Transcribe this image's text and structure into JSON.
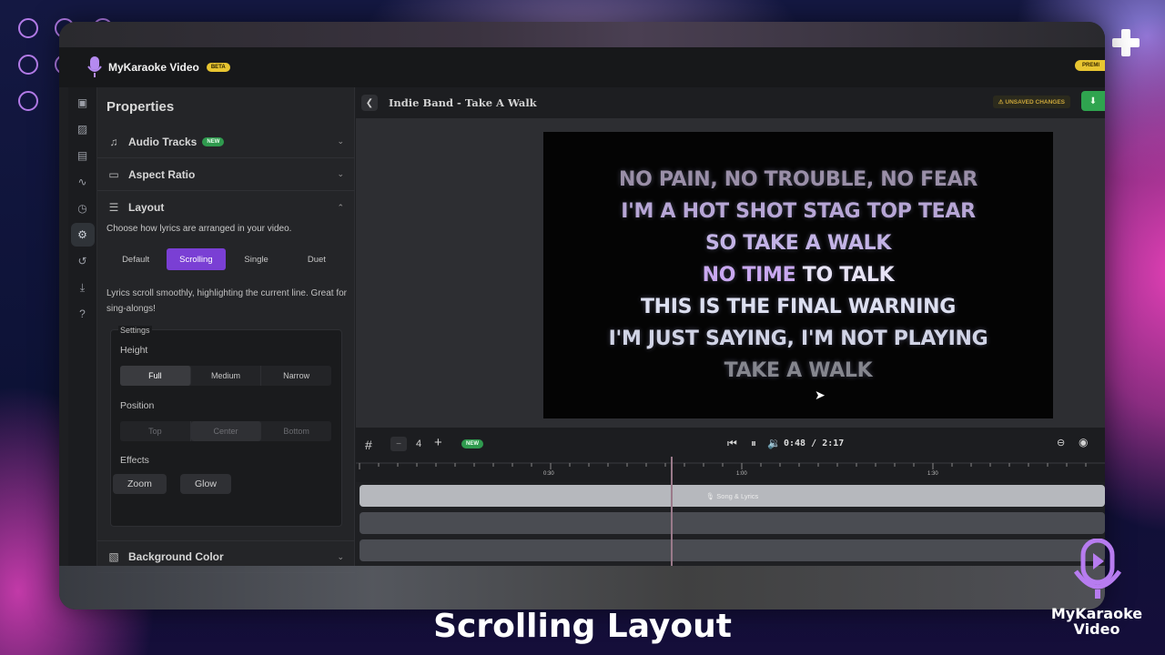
{
  "app": {
    "title": "MyKaraoke Video",
    "version_badge": "BETA",
    "premium_badge": "PREMI"
  },
  "properties": {
    "title": "Properties",
    "sections": {
      "audio": {
        "label": "Audio Tracks",
        "badge": "NEW"
      },
      "aspect": {
        "label": "Aspect Ratio"
      },
      "layout": {
        "label": "Layout"
      },
      "background": {
        "label": "Background Color"
      }
    },
    "layout_description": "Choose how lyrics are arranged in your video.",
    "layout_options": [
      "Default",
      "Scrolling",
      "Single",
      "Duet"
    ],
    "layout_selected": "Scrolling",
    "scroll_description": "Lyrics scroll smoothly, highlighting the current line. Great for sing-alongs!",
    "settings": {
      "legend": "Settings",
      "height_label": "Height",
      "height_options": [
        "Full",
        "Medium",
        "Narrow"
      ],
      "height_selected": "Full",
      "position_label": "Position",
      "position_options": [
        "Top",
        "Center",
        "Bottom"
      ],
      "position_selected": "Center",
      "effects_label": "Effects",
      "effects": [
        "Zoom",
        "Glow"
      ]
    }
  },
  "editor": {
    "song_title": "Indie Band - Take A Walk",
    "unsaved": "UNSAVED CHANGES",
    "lyrics": {
      "line1": "NO PAIN, NO TROUBLE, NO FEAR",
      "line2": "I'M A HOT SHOT STAG TOP TEAR",
      "line3": "SO TAKE A WALK",
      "line4_highlight": "NO TIME",
      "line4_rest": " TO TALK",
      "line5": "THIS IS THE FINAL WARNING",
      "line6": "I'M JUST SAYING, I'M NOT PLAYING",
      "line7": "TAKE A WALK"
    }
  },
  "timeline": {
    "grid_value": "4",
    "badge": "NEW",
    "time_current": "0:48",
    "time_separator": "/",
    "time_total": "2:17",
    "ruler_labels": [
      "0:30",
      "1:00",
      "1:30"
    ],
    "main_track_label": "Song & Lyrics"
  },
  "caption": "Scrolling Layout",
  "brand": {
    "line1": "MyKaraoke",
    "line2": "Video"
  },
  "colors": {
    "accent": "#7a3fd4",
    "new_badge": "#2f9a4e",
    "save": "#2fa44f",
    "premium": "#e8c531"
  }
}
